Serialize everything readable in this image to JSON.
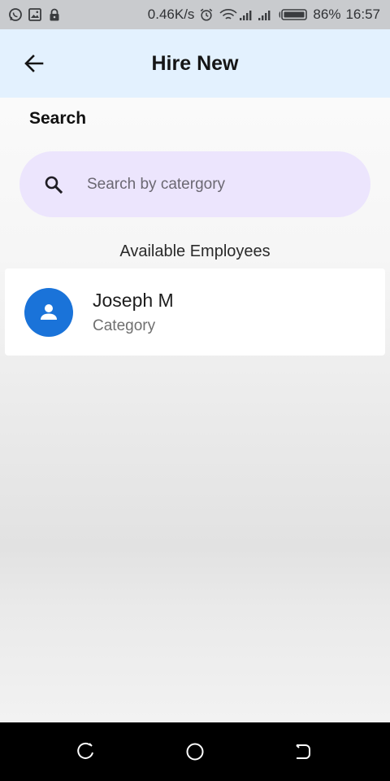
{
  "status_bar": {
    "network_speed": "0.46K/s",
    "battery": "86%",
    "time": "16:57",
    "left_icons": [
      "whatsapp-icon",
      "gallery-icon",
      "lock-icon"
    ],
    "right_icons": [
      "alarm-icon",
      "wifi-icon",
      "signal-icon",
      "signal-icon",
      "battery-icon"
    ]
  },
  "app_bar": {
    "title": "Hire New",
    "back_icon": "arrow-left-icon"
  },
  "search": {
    "section_title": "Search",
    "placeholder": "Search by catergory",
    "value": "",
    "icon": "search-icon"
  },
  "employees": {
    "heading": "Available Employees",
    "items": [
      {
        "name": "Joseph M",
        "category": "Category",
        "avatar_icon": "person-icon"
      }
    ]
  },
  "colors": {
    "app_bar_bg": "#e3f1fe",
    "search_bg": "#ece5fd",
    "avatar_bg": "#1a73d9"
  },
  "nav_bar": {
    "buttons": [
      "recent-apps-icon",
      "home-icon",
      "back-icon"
    ]
  }
}
